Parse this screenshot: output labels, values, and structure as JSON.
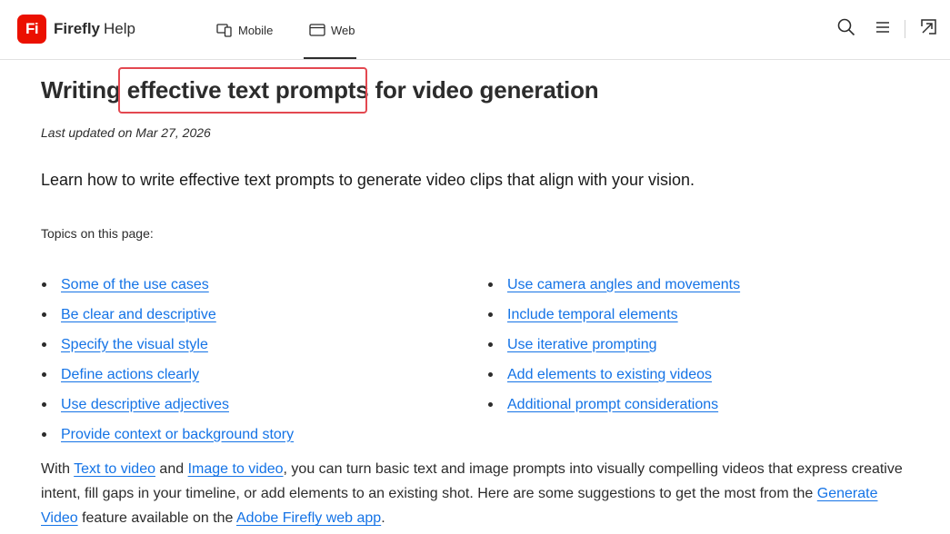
{
  "header": {
    "logo_text": "Fi",
    "brand_name": "Firefly",
    "brand_suffix": "Help",
    "tabs": [
      {
        "label": "Mobile",
        "icon": "devices-icon"
      },
      {
        "label": "Web",
        "icon": "browser-window-icon",
        "active": true
      }
    ],
    "tools": [
      "search-icon",
      "menu-icon",
      "open-external-icon"
    ]
  },
  "article": {
    "title_before": "Writing ",
    "title_highlight": "effective text prompts",
    "title_after": " for video generation",
    "updated": "Last updated on Mar 27, 2026",
    "lead": "Learn how to write effective text prompts to generate video clips that align with your vision.",
    "topics_label": "Topics on this page:",
    "topics_left": [
      "Some of the use cases",
      "Be clear and descriptive",
      "Specify the visual style ",
      "Define actions clearly",
      "Use descriptive adjectives",
      "Provide context or background story "
    ],
    "topics_right": [
      "Use camera angles and movements ",
      "Include temporal elements",
      "Use iterative prompting",
      "Add elements to existing videos ",
      "Additional prompt considerations"
    ],
    "para": {
      "t1": "With ",
      "link1": "Text to video",
      "t2": " and ",
      "link2": "Image to video",
      "t3": ", you can turn basic text and image prompts into visually compelling videos that express creative intent, fill gaps in your timeline, or add elements to an existing shot. Here are some suggestions to get the most from the ",
      "link3": "Generate Video",
      "t4": " feature available on the ",
      "link4": "Adobe Firefly web app",
      "t5": "."
    }
  },
  "colors": {
    "brand_red": "#eb1000",
    "link": "#1473e6",
    "highlight_border": "#e34850"
  }
}
